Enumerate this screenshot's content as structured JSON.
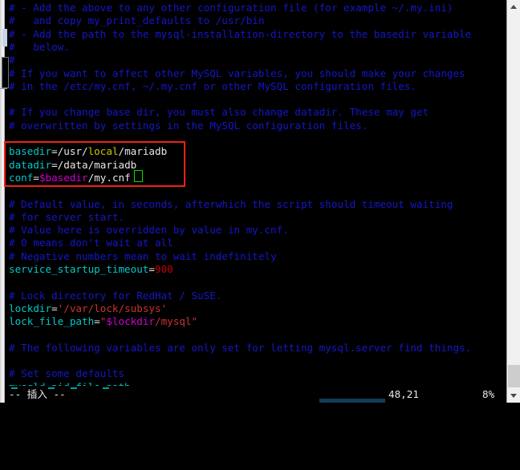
{
  "window": {
    "kind": "terminal-text-editor",
    "background": "#000000"
  },
  "editor": {
    "name": "vim",
    "file_kind": "shell-configuration",
    "lines": [
      {
        "indent": 0,
        "tokens": [
          {
            "t": "# - Add the above to any other configuration file (for example ~/.my.ini)",
            "c": "c-comment"
          }
        ]
      },
      {
        "indent": 0,
        "tokens": [
          {
            "t": "#   and copy my_print_defaults to /usr/bin",
            "c": "c-comment"
          }
        ]
      },
      {
        "indent": 0,
        "tokens": [
          {
            "t": "# - Add the path to the mysql-installation-directory to the basedir variable",
            "c": "c-comment"
          }
        ]
      },
      {
        "indent": 0,
        "tokens": [
          {
            "t": "#   below.",
            "c": "c-comment"
          }
        ]
      },
      {
        "indent": 0,
        "tokens": [
          {
            "t": "#",
            "c": "c-comment"
          }
        ]
      },
      {
        "indent": 0,
        "tokens": [
          {
            "t": "# If you want to affect other MySQL variables, you should make your changes",
            "c": "c-comment"
          }
        ]
      },
      {
        "indent": 0,
        "tokens": [
          {
            "t": "# in the /etc/my.cnf, ~/.my.cnf or other MySQL configuration files.",
            "c": "c-comment"
          }
        ]
      },
      {
        "indent": 0,
        "tokens": []
      },
      {
        "indent": 0,
        "tokens": [
          {
            "t": "# If you change base dir, you must also change datadir. These may get",
            "c": "c-comment"
          }
        ]
      },
      {
        "indent": 0,
        "tokens": [
          {
            "t": "# overwritten by settings in the MySQL configuration files.",
            "c": "c-comment"
          }
        ]
      },
      {
        "indent": 0,
        "tokens": []
      },
      {
        "indent": 0,
        "tokens": [
          {
            "t": "basedir",
            "c": "c-ident"
          },
          {
            "t": "=/usr/",
            "c": "c-plain"
          },
          {
            "t": "local",
            "c": "c-yellow"
          },
          {
            "t": "/mariadb",
            "c": "c-plain"
          }
        ]
      },
      {
        "indent": 0,
        "tokens": [
          {
            "t": "datadir",
            "c": "c-ident"
          },
          {
            "t": "=/data/mariadb",
            "c": "c-plain"
          }
        ]
      },
      {
        "indent": 0,
        "tokens": [
          {
            "t": "conf",
            "c": "c-ident"
          },
          {
            "t": "=",
            "c": "c-plain"
          },
          {
            "t": "$basedir",
            "c": "c-var"
          },
          {
            "t": "/my.cnf",
            "c": "c-plain"
          }
        ]
      },
      {
        "indent": 0,
        "tokens": []
      },
      {
        "indent": 0,
        "tokens": [
          {
            "t": "# Default value, in seconds, afterwhich the script should timeout waiting",
            "c": "c-comment"
          }
        ]
      },
      {
        "indent": 0,
        "tokens": [
          {
            "t": "# for server start.",
            "c": "c-comment"
          }
        ]
      },
      {
        "indent": 0,
        "tokens": [
          {
            "t": "# Value here is overridden by value in my.cnf.",
            "c": "c-comment"
          }
        ]
      },
      {
        "indent": 0,
        "tokens": [
          {
            "t": "# 0 means don't wait at all",
            "c": "c-comment"
          }
        ]
      },
      {
        "indent": 0,
        "tokens": [
          {
            "t": "# Negative numbers mean to wait indefinitely",
            "c": "c-comment"
          }
        ]
      },
      {
        "indent": 0,
        "tokens": [
          {
            "t": "service_startup_timeout",
            "c": "c-ident"
          },
          {
            "t": "=",
            "c": "c-plain"
          },
          {
            "t": "900",
            "c": "c-number"
          }
        ]
      },
      {
        "indent": 0,
        "tokens": []
      },
      {
        "indent": 0,
        "tokens": [
          {
            "t": "# Lock directory for RedHat / SuSE.",
            "c": "c-comment"
          }
        ]
      },
      {
        "indent": 0,
        "tokens": [
          {
            "t": "lockdir",
            "c": "c-ident"
          },
          {
            "t": "=",
            "c": "c-plain"
          },
          {
            "t": "'/var/lock/subsys'",
            "c": "c-string"
          }
        ]
      },
      {
        "indent": 0,
        "tokens": [
          {
            "t": "lock_file_path",
            "c": "c-ident"
          },
          {
            "t": "=",
            "c": "c-plain"
          },
          {
            "t": "\"",
            "c": "c-string"
          },
          {
            "t": "$lockdir",
            "c": "c-var"
          },
          {
            "t": "/mysql\"",
            "c": "c-string"
          }
        ]
      },
      {
        "indent": 0,
        "tokens": []
      },
      {
        "indent": 0,
        "tokens": [
          {
            "t": "# The following variables are only set for letting mysql.server find things.",
            "c": "c-comment"
          }
        ]
      },
      {
        "indent": 0,
        "tokens": []
      },
      {
        "indent": 0,
        "tokens": [
          {
            "t": "# Set some defaults",
            "c": "c-comment"
          }
        ]
      },
      {
        "indent": 0,
        "tokens": [
          {
            "t": "mysqld_pid_file_path",
            "c": "c-ident"
          },
          {
            "t": "=",
            "c": "c-plain"
          }
        ]
      }
    ]
  },
  "annotation": {
    "label": "red-highlight-rectangle",
    "color": "#ee2211",
    "covers_lines": "basedir / datadir / conf"
  },
  "cursor": {
    "color": "#00e000",
    "shape": "hollow-block"
  },
  "status_bar": {
    "mode": "-- 插入 --",
    "position": "48,21",
    "percent": "8%"
  },
  "scrollbar": {
    "up_arrow": "chevron-up-icon",
    "down_arrow": "chevron-down-icon",
    "thumb_position": "near-bottom"
  }
}
